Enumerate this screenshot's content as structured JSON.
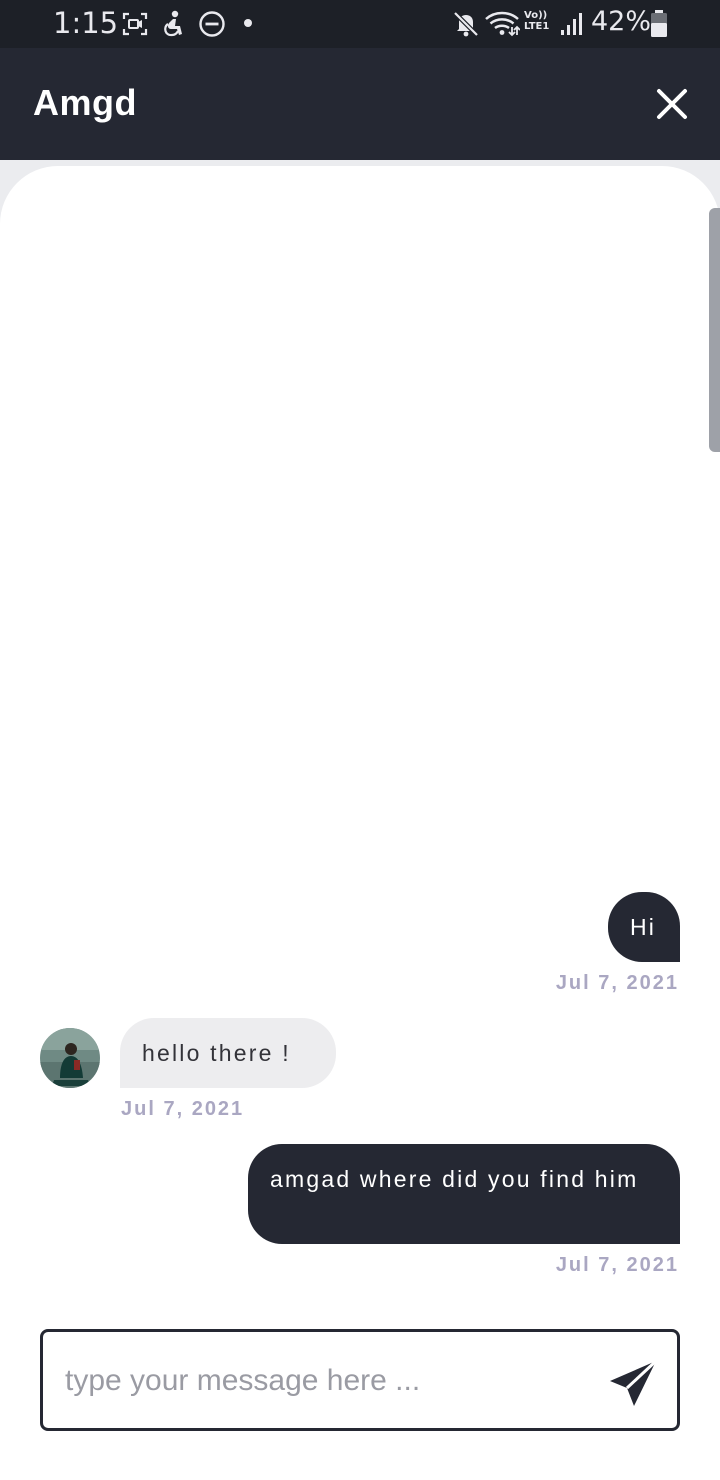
{
  "status_bar": {
    "time": "1:15",
    "network_label": "Vo))\nLTE1",
    "battery_text": "42%",
    "icons": [
      "screen-recorder-icon",
      "accessibility-icon",
      "do-not-disturb-icon",
      "notification-dot-icon",
      "mute-icon",
      "wifi-icon",
      "lte-icon",
      "signal-icon",
      "battery-icon"
    ]
  },
  "header": {
    "title": "Amgd",
    "close_icon": "close-icon"
  },
  "messages": [
    {
      "direction": "outgoing",
      "text": "Hi",
      "date": "Jul 7, 2021"
    },
    {
      "direction": "incoming",
      "text": "hello there !",
      "date": "Jul 7, 2021",
      "avatar": "contact-avatar"
    },
    {
      "direction": "outgoing",
      "text": "amgad where did you find him",
      "date": "Jul 7, 2021"
    }
  ],
  "composer": {
    "placeholder": "type your message here ...",
    "value": "",
    "send_icon": "send-icon"
  },
  "colors": {
    "header_bg": "#252833",
    "statusbar_bg": "#1d2027",
    "outgoing_bubble": "#252833",
    "incoming_bubble": "#ededef",
    "date_text": "#aaa7c2"
  }
}
